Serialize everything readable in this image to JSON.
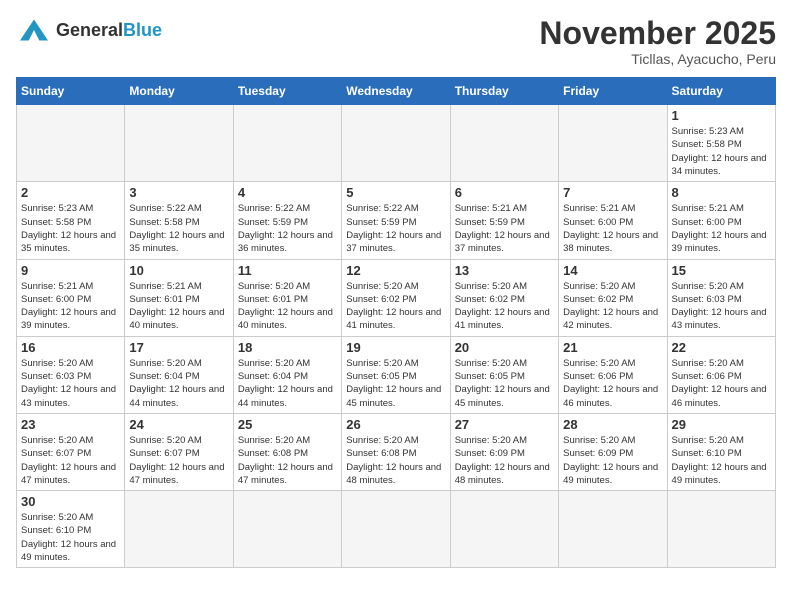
{
  "header": {
    "logo_general": "General",
    "logo_blue": "Blue",
    "month_year": "November 2025",
    "location": "Ticllas, Ayacucho, Peru"
  },
  "weekdays": [
    "Sunday",
    "Monday",
    "Tuesday",
    "Wednesday",
    "Thursday",
    "Friday",
    "Saturday"
  ],
  "weeks": [
    [
      {
        "day": "",
        "info": ""
      },
      {
        "day": "",
        "info": ""
      },
      {
        "day": "",
        "info": ""
      },
      {
        "day": "",
        "info": ""
      },
      {
        "day": "",
        "info": ""
      },
      {
        "day": "",
        "info": ""
      },
      {
        "day": "1",
        "info": "Sunrise: 5:23 AM\nSunset: 5:58 PM\nDaylight: 12 hours and 34 minutes."
      }
    ],
    [
      {
        "day": "2",
        "info": "Sunrise: 5:23 AM\nSunset: 5:58 PM\nDaylight: 12 hours and 35 minutes."
      },
      {
        "day": "3",
        "info": "Sunrise: 5:22 AM\nSunset: 5:58 PM\nDaylight: 12 hours and 35 minutes."
      },
      {
        "day": "4",
        "info": "Sunrise: 5:22 AM\nSunset: 5:59 PM\nDaylight: 12 hours and 36 minutes."
      },
      {
        "day": "5",
        "info": "Sunrise: 5:22 AM\nSunset: 5:59 PM\nDaylight: 12 hours and 37 minutes."
      },
      {
        "day": "6",
        "info": "Sunrise: 5:21 AM\nSunset: 5:59 PM\nDaylight: 12 hours and 37 minutes."
      },
      {
        "day": "7",
        "info": "Sunrise: 5:21 AM\nSunset: 6:00 PM\nDaylight: 12 hours and 38 minutes."
      },
      {
        "day": "8",
        "info": "Sunrise: 5:21 AM\nSunset: 6:00 PM\nDaylight: 12 hours and 39 minutes."
      }
    ],
    [
      {
        "day": "9",
        "info": "Sunrise: 5:21 AM\nSunset: 6:00 PM\nDaylight: 12 hours and 39 minutes."
      },
      {
        "day": "10",
        "info": "Sunrise: 5:21 AM\nSunset: 6:01 PM\nDaylight: 12 hours and 40 minutes."
      },
      {
        "day": "11",
        "info": "Sunrise: 5:20 AM\nSunset: 6:01 PM\nDaylight: 12 hours and 40 minutes."
      },
      {
        "day": "12",
        "info": "Sunrise: 5:20 AM\nSunset: 6:02 PM\nDaylight: 12 hours and 41 minutes."
      },
      {
        "day": "13",
        "info": "Sunrise: 5:20 AM\nSunset: 6:02 PM\nDaylight: 12 hours and 41 minutes."
      },
      {
        "day": "14",
        "info": "Sunrise: 5:20 AM\nSunset: 6:02 PM\nDaylight: 12 hours and 42 minutes."
      },
      {
        "day": "15",
        "info": "Sunrise: 5:20 AM\nSunset: 6:03 PM\nDaylight: 12 hours and 43 minutes."
      }
    ],
    [
      {
        "day": "16",
        "info": "Sunrise: 5:20 AM\nSunset: 6:03 PM\nDaylight: 12 hours and 43 minutes."
      },
      {
        "day": "17",
        "info": "Sunrise: 5:20 AM\nSunset: 6:04 PM\nDaylight: 12 hours and 44 minutes."
      },
      {
        "day": "18",
        "info": "Sunrise: 5:20 AM\nSunset: 6:04 PM\nDaylight: 12 hours and 44 minutes."
      },
      {
        "day": "19",
        "info": "Sunrise: 5:20 AM\nSunset: 6:05 PM\nDaylight: 12 hours and 45 minutes."
      },
      {
        "day": "20",
        "info": "Sunrise: 5:20 AM\nSunset: 6:05 PM\nDaylight: 12 hours and 45 minutes."
      },
      {
        "day": "21",
        "info": "Sunrise: 5:20 AM\nSunset: 6:06 PM\nDaylight: 12 hours and 46 minutes."
      },
      {
        "day": "22",
        "info": "Sunrise: 5:20 AM\nSunset: 6:06 PM\nDaylight: 12 hours and 46 minutes."
      }
    ],
    [
      {
        "day": "23",
        "info": "Sunrise: 5:20 AM\nSunset: 6:07 PM\nDaylight: 12 hours and 47 minutes."
      },
      {
        "day": "24",
        "info": "Sunrise: 5:20 AM\nSunset: 6:07 PM\nDaylight: 12 hours and 47 minutes."
      },
      {
        "day": "25",
        "info": "Sunrise: 5:20 AM\nSunset: 6:08 PM\nDaylight: 12 hours and 47 minutes."
      },
      {
        "day": "26",
        "info": "Sunrise: 5:20 AM\nSunset: 6:08 PM\nDaylight: 12 hours and 48 minutes."
      },
      {
        "day": "27",
        "info": "Sunrise: 5:20 AM\nSunset: 6:09 PM\nDaylight: 12 hours and 48 minutes."
      },
      {
        "day": "28",
        "info": "Sunrise: 5:20 AM\nSunset: 6:09 PM\nDaylight: 12 hours and 49 minutes."
      },
      {
        "day": "29",
        "info": "Sunrise: 5:20 AM\nSunset: 6:10 PM\nDaylight: 12 hours and 49 minutes."
      }
    ],
    [
      {
        "day": "30",
        "info": "Sunrise: 5:20 AM\nSunset: 6:10 PM\nDaylight: 12 hours and 49 minutes."
      },
      {
        "day": "",
        "info": ""
      },
      {
        "day": "",
        "info": ""
      },
      {
        "day": "",
        "info": ""
      },
      {
        "day": "",
        "info": ""
      },
      {
        "day": "",
        "info": ""
      },
      {
        "day": "",
        "info": ""
      }
    ]
  ]
}
